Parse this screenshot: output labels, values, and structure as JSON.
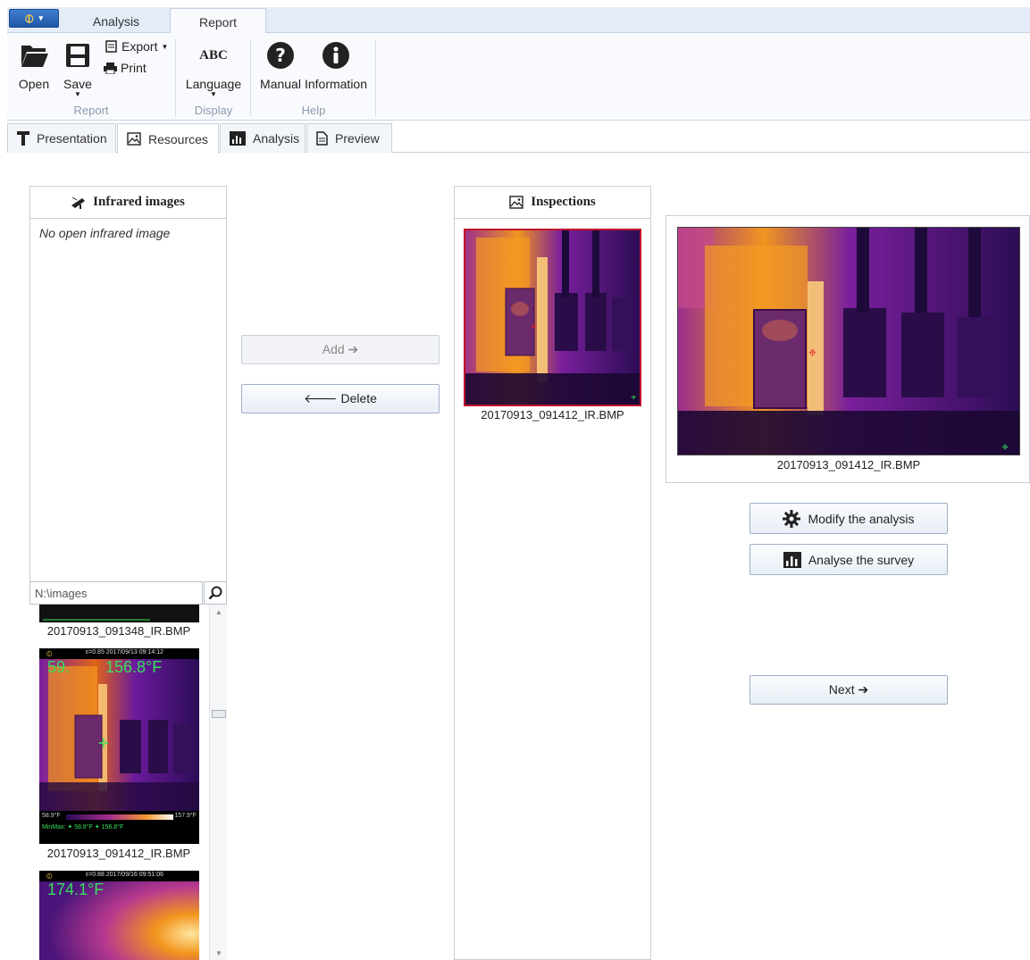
{
  "ribbon": {
    "tabs": [
      {
        "label": "Analysis"
      },
      {
        "label": "Report"
      }
    ],
    "active_tab": "Report",
    "groups": [
      {
        "label": "Report",
        "buttons": [
          {
            "label": "Open",
            "icon": "folder-open-icon"
          },
          {
            "label": "Save",
            "icon": "save-icon"
          },
          {
            "label": "Export",
            "icon": "export-icon"
          },
          {
            "label": "Print",
            "icon": "print-icon"
          }
        ]
      },
      {
        "label": "Display",
        "buttons": [
          {
            "label": "Language",
            "icon": "abc-icon",
            "icon_text": "ABC"
          }
        ]
      },
      {
        "label": "Help",
        "buttons": [
          {
            "label": "Manual",
            "icon": "question-circle-icon"
          },
          {
            "label": "Information",
            "icon": "info-circle-icon"
          }
        ]
      }
    ]
  },
  "page_tabs": [
    {
      "label": "Presentation",
      "icon": "text-t-icon"
    },
    {
      "label": "Resources",
      "icon": "image-icon",
      "active": true
    },
    {
      "label": "Analysis",
      "icon": "bar-chart-icon"
    },
    {
      "label": "Preview",
      "icon": "document-icon"
    }
  ],
  "infrared_panel": {
    "title": "Infrared images",
    "empty_text": "No open infrared image",
    "path": "N:\\images",
    "thumbnails": [
      {
        "caption": "20170913_091348_IR.BMP"
      },
      {
        "caption": "20170913_091412_IR.BMP",
        "overlay_temp_left": "59.",
        "overlay_temp_right": "156.8°F",
        "scale_min": "58.9°F",
        "scale_max": "157.9°F",
        "minmax_text": "MinMax: ✦ 58.8°F  ✦ 156.8°F",
        "header_text": "ε=0.85  2017/09/13 09:14:12"
      },
      {
        "caption": "",
        "overlay_temp_left": "174.1°F",
        "header_text": "ε=0.88  2017/09/16 09:51:06"
      }
    ]
  },
  "actions": {
    "add_label": "Add ➔",
    "delete_label": "🡐  Delete"
  },
  "inspections_panel": {
    "title": "Inspections",
    "items": [
      {
        "caption": "20170913_091412_IR.BMP"
      }
    ]
  },
  "preview": {
    "caption": "20170913_091412_IR.BMP"
  },
  "side_buttons": {
    "modify_label": "Modify the analysis",
    "analyse_label": "Analyse the survey",
    "next_label": "Next ➔"
  },
  "colors": {
    "accent": "#1f57a6",
    "ribbon_bg": "#e3ecf7",
    "selection_border": "#c0142b"
  }
}
